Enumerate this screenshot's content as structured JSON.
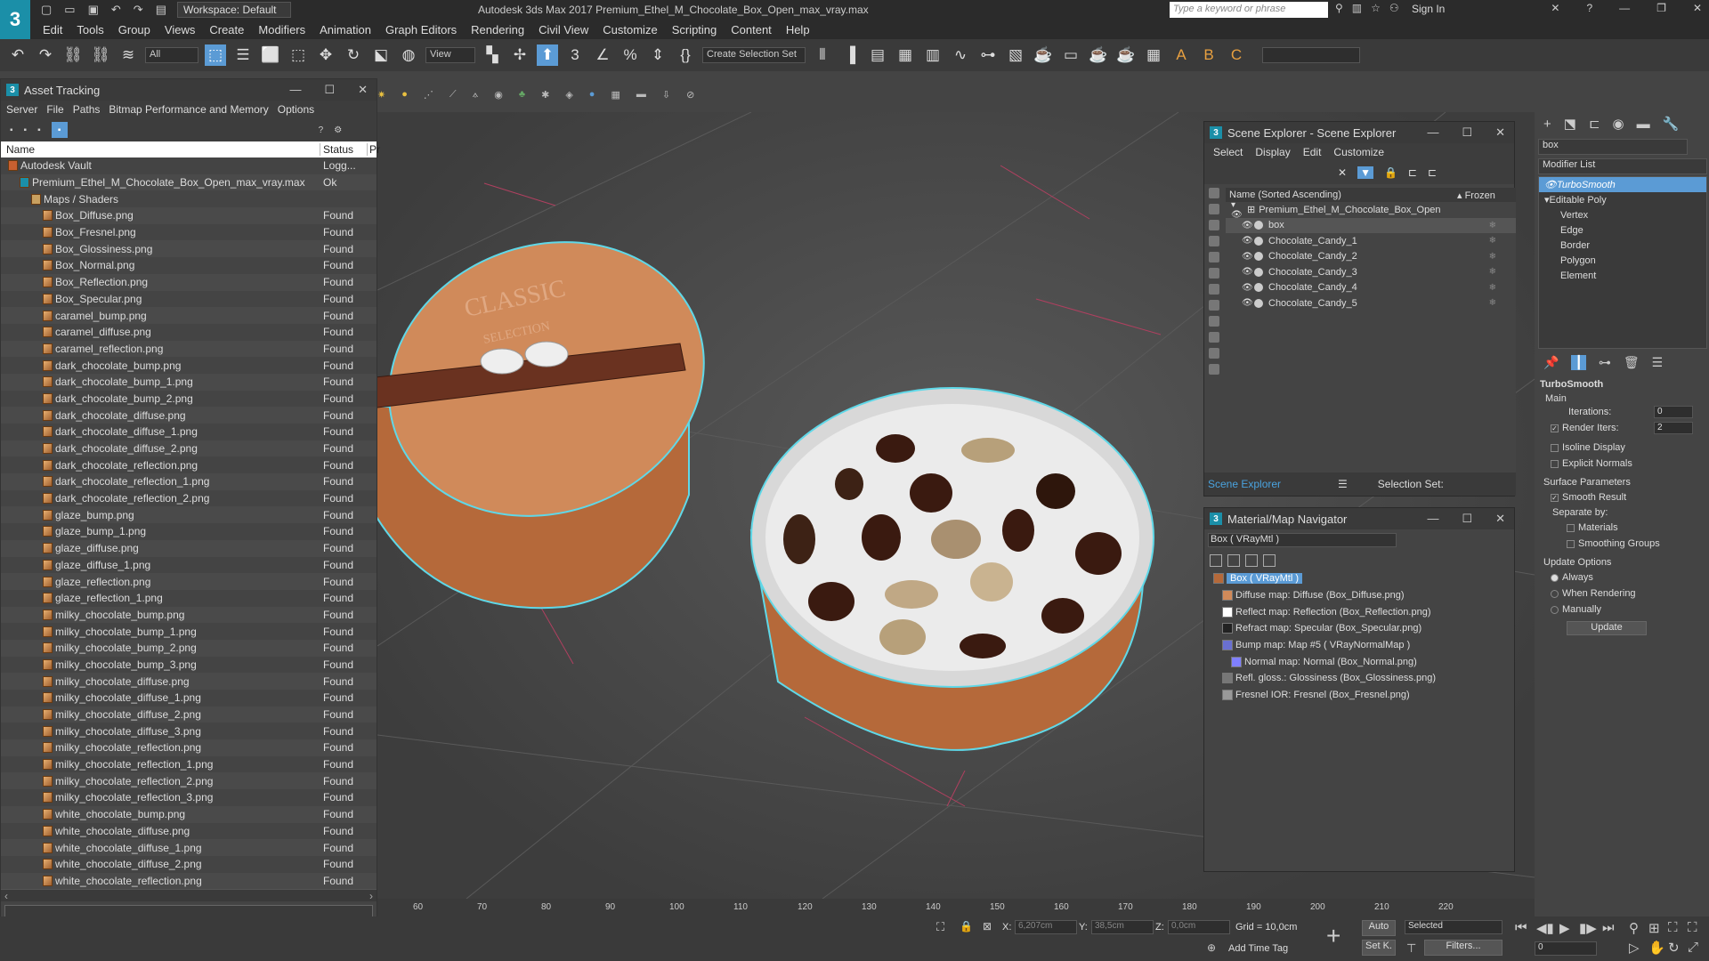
{
  "app": {
    "title": "Autodesk 3ds Max 2017    Premium_Ethel_M_Chocolate_Box_Open_max_vray.max",
    "workspace": "Workspace: Default",
    "search_placeholder": "Type a keyword or phrase",
    "sign_in": "Sign In"
  },
  "menu": [
    "Edit",
    "Tools",
    "Group",
    "Views",
    "Create",
    "Modifiers",
    "Animation",
    "Graph Editors",
    "Rendering",
    "Civil View",
    "Customize",
    "Scripting",
    "Content",
    "Help"
  ],
  "toolbar": {
    "filter": "All",
    "view": "View",
    "selection_set": "Create Selection Set"
  },
  "asset_tracking": {
    "title": "Asset Tracking",
    "menu": [
      "Server",
      "File",
      "Paths",
      "Bitmap Performance and Memory",
      "Options"
    ],
    "columns": [
      "Name",
      "Status",
      "Pr"
    ],
    "rows": [
      {
        "name": "Autodesk Vault",
        "status": "Logg...",
        "indent": 0,
        "type": "vault"
      },
      {
        "name": "Premium_Ethel_M_Chocolate_Box_Open_max_vray.max",
        "status": "Ok",
        "indent": 1,
        "type": "max"
      },
      {
        "name": "Maps / Shaders",
        "status": "",
        "indent": 2,
        "type": "folder"
      },
      {
        "name": "Box_Diffuse.png",
        "status": "Found",
        "indent": 3,
        "type": "file"
      },
      {
        "name": "Box_Fresnel.png",
        "status": "Found",
        "indent": 3,
        "type": "file"
      },
      {
        "name": "Box_Glossiness.png",
        "status": "Found",
        "indent": 3,
        "type": "file"
      },
      {
        "name": "Box_Normal.png",
        "status": "Found",
        "indent": 3,
        "type": "file"
      },
      {
        "name": "Box_Reflection.png",
        "status": "Found",
        "indent": 3,
        "type": "file"
      },
      {
        "name": "Box_Specular.png",
        "status": "Found",
        "indent": 3,
        "type": "file"
      },
      {
        "name": "caramel_bump.png",
        "status": "Found",
        "indent": 3,
        "type": "file"
      },
      {
        "name": "caramel_diffuse.png",
        "status": "Found",
        "indent": 3,
        "type": "file"
      },
      {
        "name": "caramel_reflection.png",
        "status": "Found",
        "indent": 3,
        "type": "file"
      },
      {
        "name": "dark_chocolate_bump.png",
        "status": "Found",
        "indent": 3,
        "type": "file"
      },
      {
        "name": "dark_chocolate_bump_1.png",
        "status": "Found",
        "indent": 3,
        "type": "file"
      },
      {
        "name": "dark_chocolate_bump_2.png",
        "status": "Found",
        "indent": 3,
        "type": "file"
      },
      {
        "name": "dark_chocolate_diffuse.png",
        "status": "Found",
        "indent": 3,
        "type": "file"
      },
      {
        "name": "dark_chocolate_diffuse_1.png",
        "status": "Found",
        "indent": 3,
        "type": "file"
      },
      {
        "name": "dark_chocolate_diffuse_2.png",
        "status": "Found",
        "indent": 3,
        "type": "file"
      },
      {
        "name": "dark_chocolate_reflection.png",
        "status": "Found",
        "indent": 3,
        "type": "file"
      },
      {
        "name": "dark_chocolate_reflection_1.png",
        "status": "Found",
        "indent": 3,
        "type": "file"
      },
      {
        "name": "dark_chocolate_reflection_2.png",
        "status": "Found",
        "indent": 3,
        "type": "file"
      },
      {
        "name": "glaze_bump.png",
        "status": "Found",
        "indent": 3,
        "type": "file"
      },
      {
        "name": "glaze_bump_1.png",
        "status": "Found",
        "indent": 3,
        "type": "file"
      },
      {
        "name": "glaze_diffuse.png",
        "status": "Found",
        "indent": 3,
        "type": "file"
      },
      {
        "name": "glaze_diffuse_1.png",
        "status": "Found",
        "indent": 3,
        "type": "file"
      },
      {
        "name": "glaze_reflection.png",
        "status": "Found",
        "indent": 3,
        "type": "file"
      },
      {
        "name": "glaze_reflection_1.png",
        "status": "Found",
        "indent": 3,
        "type": "file"
      },
      {
        "name": "milky_chocolate_bump.png",
        "status": "Found",
        "indent": 3,
        "type": "file"
      },
      {
        "name": "milky_chocolate_bump_1.png",
        "status": "Found",
        "indent": 3,
        "type": "file"
      },
      {
        "name": "milky_chocolate_bump_2.png",
        "status": "Found",
        "indent": 3,
        "type": "file"
      },
      {
        "name": "milky_chocolate_bump_3.png",
        "status": "Found",
        "indent": 3,
        "type": "file"
      },
      {
        "name": "milky_chocolate_diffuse.png",
        "status": "Found",
        "indent": 3,
        "type": "file"
      },
      {
        "name": "milky_chocolate_diffuse_1.png",
        "status": "Found",
        "indent": 3,
        "type": "file"
      },
      {
        "name": "milky_chocolate_diffuse_2.png",
        "status": "Found",
        "indent": 3,
        "type": "file"
      },
      {
        "name": "milky_chocolate_diffuse_3.png",
        "status": "Found",
        "indent": 3,
        "type": "file"
      },
      {
        "name": "milky_chocolate_reflection.png",
        "status": "Found",
        "indent": 3,
        "type": "file"
      },
      {
        "name": "milky_chocolate_reflection_1.png",
        "status": "Found",
        "indent": 3,
        "type": "file"
      },
      {
        "name": "milky_chocolate_reflection_2.png",
        "status": "Found",
        "indent": 3,
        "type": "file"
      },
      {
        "name": "milky_chocolate_reflection_3.png",
        "status": "Found",
        "indent": 3,
        "type": "file"
      },
      {
        "name": "white_chocolate_bump.png",
        "status": "Found",
        "indent": 3,
        "type": "file"
      },
      {
        "name": "white_chocolate_diffuse.png",
        "status": "Found",
        "indent": 3,
        "type": "file"
      },
      {
        "name": "white_chocolate_diffuse_1.png",
        "status": "Found",
        "indent": 3,
        "type": "file"
      },
      {
        "name": "white_chocolate_diffuse_2.png",
        "status": "Found",
        "indent": 3,
        "type": "file"
      },
      {
        "name": "white_chocolate_reflection.png",
        "status": "Found",
        "indent": 3,
        "type": "file"
      }
    ]
  },
  "scene_explorer": {
    "title": "Scene Explorer - Scene Explorer",
    "menu": [
      "Select",
      "Display",
      "Edit",
      "Customize"
    ],
    "col_name": "Name (Sorted Ascending)",
    "col_frozen": "▴ Frozen",
    "root": "Premium_Ethel_M_Chocolate_Box_Open",
    "items": [
      "box",
      "Chocolate_Candy_1",
      "Chocolate_Candy_2",
      "Chocolate_Candy_3",
      "Chocolate_Candy_4",
      "Chocolate_Candy_5"
    ],
    "footer_explorer": "Scene Explorer",
    "footer_selset": "Selection Set:"
  },
  "material_navigator": {
    "title": "Material/Map Navigator",
    "field": "Box  ( VRayMtl )",
    "items": [
      {
        "label": "Box  ( VRayMtl )",
        "indent": 0,
        "root": true
      },
      {
        "label": "Diffuse map: Diffuse (Box_Diffuse.png)",
        "indent": 1
      },
      {
        "label": "Reflect map: Reflection (Box_Reflection.png)",
        "indent": 1
      },
      {
        "label": "Refract map: Specular (Box_Specular.png)",
        "indent": 1
      },
      {
        "label": "Bump map: Map #5  ( VRayNormalMap )",
        "indent": 1
      },
      {
        "label": "Normal map: Normal (Box_Normal.png)",
        "indent": 2
      },
      {
        "label": "Refl. gloss.: Glossiness (Box_Glossiness.png)",
        "indent": 1
      },
      {
        "label": "Fresnel IOR: Fresnel (Box_Fresnel.png)",
        "indent": 1
      }
    ]
  },
  "command_panel": {
    "object_name": "box",
    "modifier_list": "Modifier List",
    "stack": [
      {
        "label": "TurboSmooth",
        "indent": 1,
        "selected": true
      },
      {
        "label": "Editable Poly",
        "indent": 1
      },
      {
        "label": "Vertex",
        "indent": 2
      },
      {
        "label": "Edge",
        "indent": 2
      },
      {
        "label": "Border",
        "indent": 2
      },
      {
        "label": "Polygon",
        "indent": 2
      },
      {
        "label": "Element",
        "indent": 2
      }
    ],
    "turbosmooth": {
      "header": "TurboSmooth",
      "main": "Main",
      "iterations_label": "Iterations:",
      "iterations_value": "0",
      "render_iters_label": "Render Iters:",
      "render_iters_value": "2",
      "isoline": "Isoline Display",
      "explicit_normals": "Explicit Normals",
      "surface_params": "Surface Parameters",
      "smooth_result": "Smooth Result",
      "separate_by": "Separate by:",
      "materials": "Materials",
      "smoothing_groups": "Smoothing Groups",
      "update_options": "Update Options",
      "always": "Always",
      "when_rendering": "When Rendering",
      "manually": "Manually",
      "update_btn": "Update"
    }
  },
  "viewport": {
    "lid_text_1": "CLASSIC",
    "lid_text_2": "SELECTION"
  },
  "timeline": {
    "ticks": [
      "60",
      "70",
      "80",
      "90",
      "100",
      "110",
      "120",
      "130",
      "140",
      "150",
      "160",
      "170",
      "180",
      "190",
      "200",
      "210",
      "220"
    ]
  },
  "statusbar": {
    "x_label": "X:",
    "x_value": "6,207cm",
    "y_label": "Y:",
    "y_value": "38,5cm",
    "z_label": "Z:",
    "z_value": "0,0cm",
    "grid": "Grid = 10,0cm",
    "add_time_tag": "Add Time Tag",
    "auto": "Auto",
    "set_k": "Set K.",
    "selected": "Selected",
    "filters": "Filters...",
    "frame": "0"
  },
  "colors": {
    "accent": "#5b9bd5",
    "selection_outline": "#5fd8e8",
    "box_orange": "#c87a4a"
  }
}
